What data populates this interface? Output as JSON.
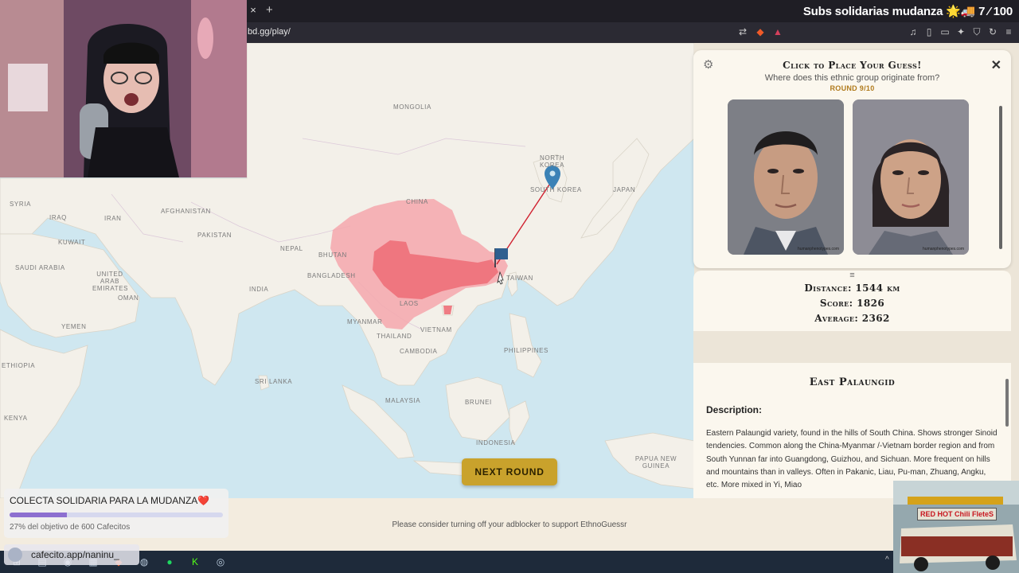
{
  "browser": {
    "tab_close": "×",
    "tab_new": "+",
    "url": "bd.gg/play/"
  },
  "overlay": {
    "title": "Subs solidarias mudanza 🌟🚚 7 ⁄ 100"
  },
  "map": {
    "labels": {
      "mongolia": "MONGOLIA",
      "north_korea": "NORTH KOREA",
      "south_korea": "SOUTH KOREA",
      "japan": "JAPAN",
      "china": "CHINA",
      "syria": "SYRIA",
      "iraq": "IRAQ",
      "iran": "IRAN",
      "afghanistan": "AFGHANISTAN",
      "pakistan": "PAKISTAN",
      "kuwait": "KUWAIT",
      "saudi_arabia": "SAUDI ARABIA",
      "uae": "UNITED ARAB EMIRATES",
      "oman": "OMAN",
      "yemen": "YEMEN",
      "nepal": "NEPAL",
      "bhutan": "BHUTAN",
      "bangladesh": "BANGLADESH",
      "india": "INDIA",
      "myanmar": "MYANMAR",
      "laos": "LAOS",
      "thailand": "THAILAND",
      "vietnam": "VIETNAM",
      "cambodia": "CAMBODIA",
      "taiwan": "TAIWAN",
      "philippines": "PHILIPPINES",
      "sri_lanka": "SRI LANKA",
      "malaysia": "MALAYSIA",
      "brunei": "BRUNEI",
      "indonesia": "INDONESIA",
      "papua_new_guinea": "PAPUA NEW GUINEA",
      "ethiopia": "ETHIOPIA",
      "kenya": "KENYA"
    },
    "next_round_label": "NEXT ROUND"
  },
  "guess_card": {
    "title": "Click to Place Your Guess!",
    "subtitle": "Where does this ethnic group originate from?",
    "round": "ROUND 9/10",
    "watermark": "humanphenotypes.com"
  },
  "result": {
    "handle": "≡",
    "distance": "Distance: 1544 km",
    "score": "Score: 1826",
    "average": "Average: 2362"
  },
  "description": {
    "title": "East Palaungid",
    "heading": "Description:",
    "body": "Eastern Palaungid variety, found in the hills of South China. Shows stronger Sinoid tendencies. Common along the China-Myanmar /-Vietnam border region and from South Yunnan far into Guangdong, Guizhou, and Sichuan. More frequent on hills and mountains than in valleys. Often in Pakanic, Liau, Pu-man, Zhuang, Angku, etc. More mixed in Yi, Miao"
  },
  "footer": {
    "text": "Please consider turning off your adblocker to support EthnoGuessr"
  },
  "donation": {
    "title": "COLECTA SOLIDARIA PARA LA MUDANZA❤️",
    "progress_percent": 27,
    "subtitle": "27% del objetivo de 600 Cafecitos",
    "link": "cafecito.app/naninu_"
  },
  "truck": {
    "sign": "RED HOT Chili FleteS"
  },
  "colors": {
    "accent_gold": "#c9a22c",
    "region_light": "#f4a7ad",
    "region_dark": "#ee6f79",
    "guess_line": "#d0202f",
    "marker_blue": "#3b82b6"
  }
}
